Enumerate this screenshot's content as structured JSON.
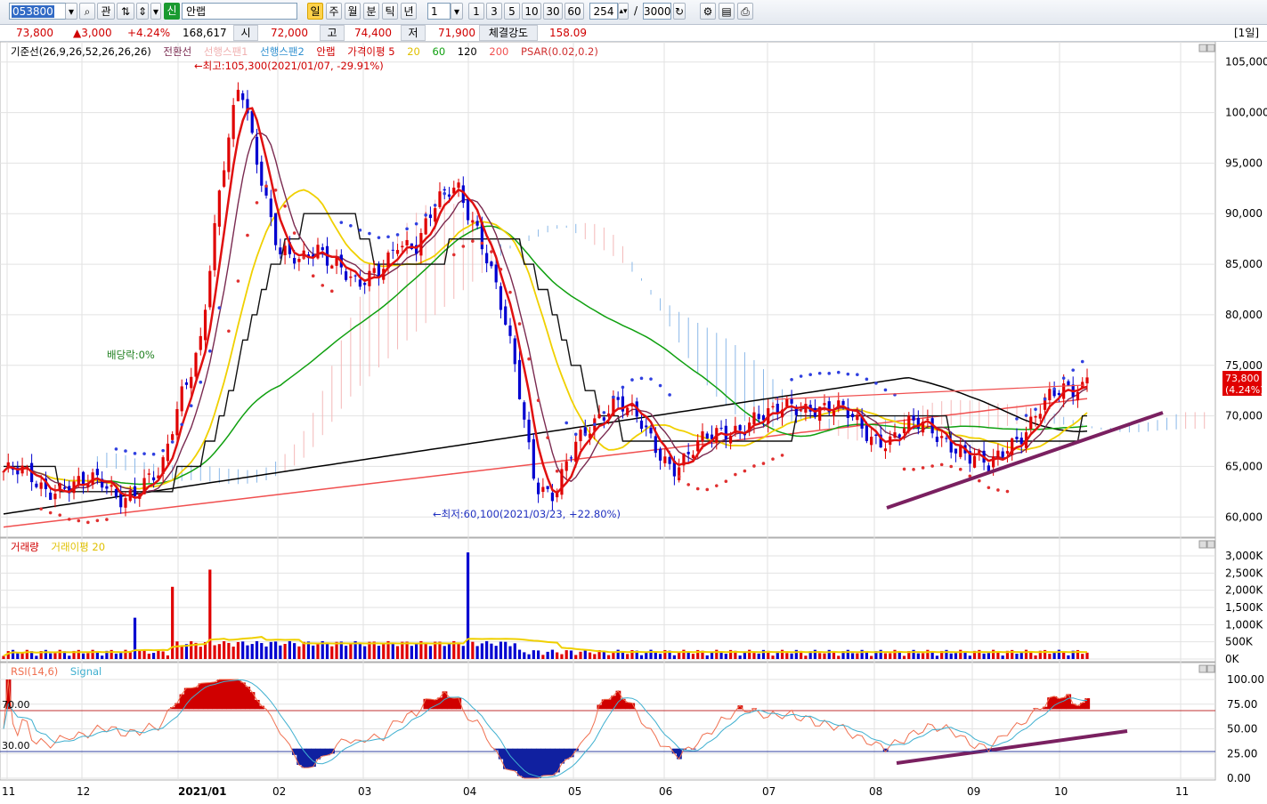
{
  "toolbar": {
    "code": "053800",
    "fav_label": "관",
    "shin_label": "신",
    "name": "안랩",
    "period_buttons": [
      "일",
      "주",
      "월",
      "분",
      "틱",
      "년"
    ],
    "interval_value": "1",
    "interval_buttons": [
      "1",
      "3",
      "5",
      "10",
      "30",
      "60"
    ],
    "count_value": "254",
    "slash": "/",
    "total_value": "3000"
  },
  "info": {
    "price": "73,800",
    "change": "▲3,000",
    "change_pct": "+4.24%",
    "volume": "168,617",
    "open_label": "시",
    "open": "72,000",
    "high_label": "고",
    "high": "74,400",
    "low_label": "저",
    "low": "71,900",
    "strength_label": "체결강도",
    "strength": "158.09",
    "period_tag": "[1일]"
  },
  "legend": {
    "kijun": "기준선(26,9,26,52,26,26,26)",
    "tenkan": "전환선",
    "senkou1": "선행스팬1",
    "senkou2": "선행스팬2",
    "stock": "안랩",
    "ma_label": "가격이평 5",
    "ma20": "20",
    "ma60": "60",
    "ma120": "120",
    "ma200": "200",
    "psar": "PSAR(0.02,0.2)"
  },
  "annotations": {
    "high": "최고:105,300(2021/01/07, -29.91%)",
    "low": "최저:60,100(2021/03/23, +22.80%)",
    "dividend": "배당락:0%",
    "last_price": "73,800",
    "last_pct": "(4.24%)"
  },
  "volume_legend": {
    "volume": "거래량",
    "avg": "거래이평 20"
  },
  "rsi_legend": {
    "rsi": "RSI(14,6)",
    "signal": "Signal",
    "upper": "70.00",
    "lower": "30.00"
  },
  "colors": {
    "up": "#e00000",
    "down": "#0000d0",
    "ma5": "#e01010",
    "ma20": "#f0d000",
    "ma60": "#10a010",
    "ma120": "#000000",
    "ma200": "#f05050",
    "psar": "#e03030",
    "trend": "#7a2060"
  },
  "chart_data": {
    "type": "line",
    "price_axis": {
      "ticks": [
        "105,000",
        "100,000",
        "95,000",
        "90,000",
        "85,000",
        "80,000",
        "75,000",
        "70,000",
        "65,000",
        "60,000"
      ],
      "ylim": [
        58000,
        107000
      ]
    },
    "volume_axis": {
      "ticks": [
        "3,000K",
        "2,500K",
        "2,000K",
        "1,500K",
        "1,000K",
        "500K",
        "0K"
      ]
    },
    "rsi_axis": {
      "ticks": [
        "100.00",
        "75.00",
        "50.00",
        "25.00",
        "0.00"
      ]
    },
    "x_labels": [
      "11",
      "12",
      "2021/01",
      "02",
      "03",
      "04",
      "05",
      "06",
      "07",
      "08",
      "09",
      "10",
      "11"
    ],
    "close_series": [
      64500,
      63800,
      63000,
      63500,
      62800,
      63200,
      62500,
      63000,
      63600,
      72500,
      78000,
      92000,
      103000,
      95000,
      86000,
      84500,
      87000,
      85500,
      82000,
      84000,
      88000,
      86500,
      90500,
      93500,
      89000,
      82000,
      74500,
      64000,
      61800,
      66500,
      70000,
      72000,
      69500,
      67000,
      65500,
      66500,
      67500,
      69000,
      70000,
      69500,
      71000,
      71500,
      70500,
      69500,
      68500,
      67800,
      68500,
      69000,
      68000,
      65500,
      64500,
      67800,
      69000,
      71000,
      72800,
      73800
    ]
  }
}
